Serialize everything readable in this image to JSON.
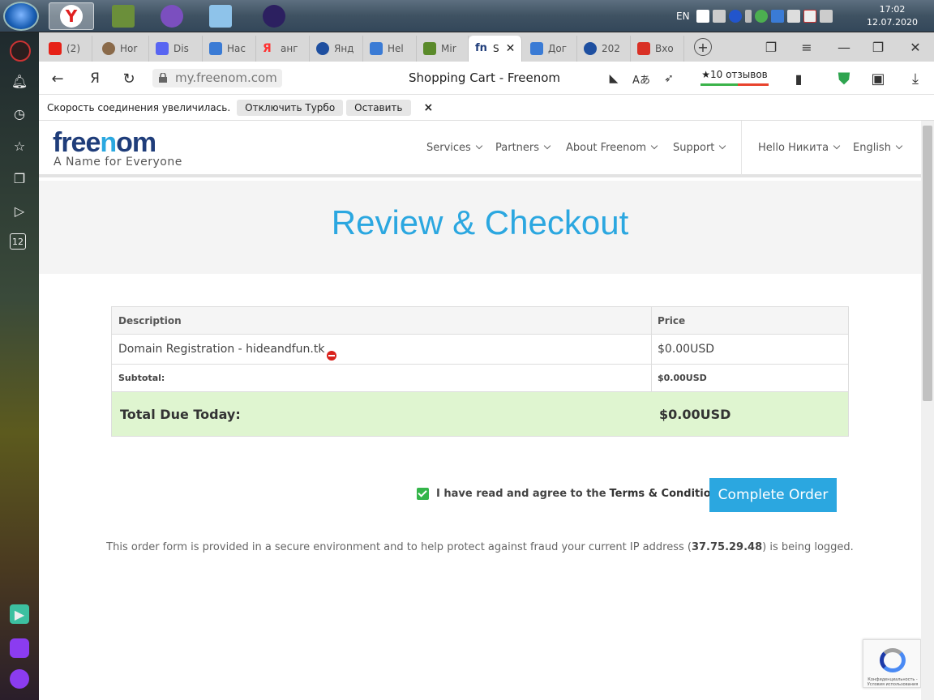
{
  "taskbar": {
    "language": "EN",
    "time": "17:02",
    "date": "12.07.2020",
    "apps": [
      {
        "name": "yandex-browser",
        "color": "#e02020",
        "glyph": "Y",
        "active": true
      },
      {
        "name": "minecraft",
        "color": "#5a8a2a",
        "glyph": ""
      },
      {
        "name": "viber",
        "color": "#7b4fbf",
        "glyph": ""
      },
      {
        "name": "notepad",
        "color": "#6fa8dc",
        "glyph": ""
      },
      {
        "name": "eclipse",
        "color": "#2c2060",
        "glyph": ""
      }
    ]
  },
  "tabs": [
    {
      "label": "(2)",
      "color": "#e62117"
    },
    {
      "label": "Hor",
      "color": "#8a6a4a"
    },
    {
      "label": "Dis",
      "color": "#5865f2"
    },
    {
      "label": "Hac",
      "color": "#3a7bd5"
    },
    {
      "label": "анг",
      "color": "#ff3333"
    },
    {
      "label": "Янд",
      "color": "#1e4fa0"
    },
    {
      "label": "Hel",
      "color": "#3a7bd5"
    },
    {
      "label": "Mir",
      "color": "#5a8a2a"
    },
    {
      "label": "S",
      "color": "#1f3d7a",
      "active": true
    },
    {
      "label": "Дог",
      "color": "#3a7bd5"
    },
    {
      "label": "202",
      "color": "#1e4fa0"
    },
    {
      "label": "Вхо",
      "color": "#d93025"
    }
  ],
  "address_bar": {
    "url": "my.freenom.com",
    "page_title": "Shopping Cart - Freenom",
    "reviews": "★10 отзывов"
  },
  "turbo_bar": {
    "message": "Скорость соединения увеличилась.",
    "disable_label": "Отключить Турбо",
    "keep_label": "Оставить",
    "close_label": "×"
  },
  "site": {
    "logo_prefix": "free",
    "logo_highlight": "n",
    "logo_suffix": "om",
    "tagline": "A Name for Everyone",
    "nav": [
      "Services",
      "Partners",
      "About Freenom",
      "Support"
    ],
    "user_greeting": "Hello Никита",
    "language": "English"
  },
  "hero": {
    "title": "Review & Checkout"
  },
  "cart": {
    "header": {
      "description": "Description",
      "price": "Price"
    },
    "item": {
      "description": "Domain Registration - hideandfun.tk",
      "price": "$0.00USD"
    },
    "subtotal": {
      "label": "Subtotal:",
      "value": "$0.00USD"
    },
    "total": {
      "label": "Total Due Today:",
      "value": "$0.00USD"
    }
  },
  "checkout": {
    "agree_text": "I have read and agree to the",
    "terms_link": "Terms & Conditions",
    "agreed": true,
    "button_label": "Complete Order"
  },
  "notice": {
    "before": "This order form is provided in a secure environment and to help protect against fraud your current IP address (",
    "ip": "37.75.29.48",
    "after": ") is being logged."
  },
  "recaptcha": {
    "text": "Конфиденциальность - Условия использования"
  }
}
